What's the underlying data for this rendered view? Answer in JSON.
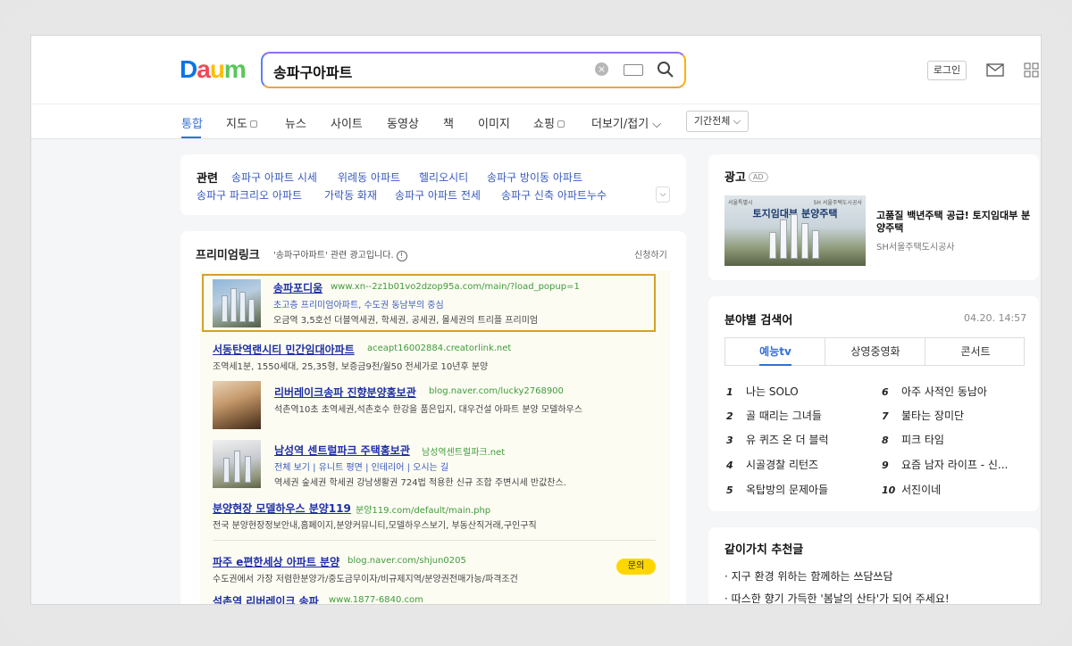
{
  "header": {
    "logo": {
      "d": "D",
      "a": "a",
      "u": "u",
      "m": "m"
    },
    "search_query": "송파구아파트",
    "login_label": "로그인"
  },
  "tabs": [
    {
      "label": "통합",
      "active": true
    },
    {
      "label": "지도",
      "icon": true
    },
    {
      "label": "뉴스"
    },
    {
      "label": "사이트"
    },
    {
      "label": "동영상"
    },
    {
      "label": "책"
    },
    {
      "label": "이미지"
    },
    {
      "label": "쇼핑",
      "icon": true
    },
    {
      "label": "더보기/접기 ⌵"
    }
  ],
  "period_filter": "기간전체 ⌵",
  "related": {
    "title": "관련",
    "links": [
      "송파구 아파트 시세",
      "위례동 아파트",
      "헬리오시티",
      "송파구 방이동 아파트",
      "송파구 파크리오 아파트",
      "가락동 화재",
      "송파구 아파트 전세",
      "송파구 신축 아파트누수"
    ]
  },
  "premium": {
    "title": "프리미엄링크",
    "subtitle": "'송파구아파트' 관련 광고입니다.",
    "apply": "신청하기",
    "ads": [
      {
        "title": "송파포디움",
        "url": "www.xn--2z1b01vo2dzop95a.com/main/?load_popup=1",
        "sub": "초고층 프리미엄아파트, 수도권 동남부의 중심",
        "desc": "오금역 3,5호선 더블역세권, 학세권, 공세권, 몰세권의 트리플 프리미엄"
      },
      {
        "title": "서동탄역랜시티 민간임대아파트",
        "url": "aceapt16002884.creatorlink.net",
        "desc": "조역세1분, 1550세대, 25,35형, 보증금9천/월50 전세가로 10년후 분양"
      },
      {
        "title": "리버레이크송파 진향분양홍보관",
        "url": "blog.naver.com/lucky2768900",
        "desc": "석촌역10초 초역세권,석촌호수 한강을 품은입지, 대우건설 아파트 분양 모델하우스"
      },
      {
        "title": "남성역 센트럴파크 주택홍보관",
        "url": "남성역센트럴파크.net",
        "sub": "전체 보기 | 유니트 평면 | 인테리어 | 오시는 길",
        "desc": "역세권 숲세권 학세권 강남생활권 724법 적용한 신규 조합 주변시세 반값찬스."
      },
      {
        "title": "분양현장 모델하우스 분양119",
        "url": "분양119.com/default/main.php",
        "desc": "전국 분양현장정보안내,홈페이지,분양커뮤니티,모델하우스보기, 부동산직거래,구인구직"
      },
      {
        "title": "파주 e편한세상 아파트 분양",
        "url": "blog.naver.com/shjun0205",
        "desc": "수도권에서 가장 저렴한분양가/중도금무이자/비규제지역/분양권전매가능/파격조건",
        "badge": "문의"
      },
      {
        "title": "석촌역 리버레이크 송파",
        "url": "www.1877-6840.com"
      }
    ]
  },
  "side_ad": {
    "title": "광고",
    "badge": "AD",
    "banner_title": "토지임대부 분양주택",
    "banner_left": "서울특별시",
    "banner_right": "SH 서울주택도시공사",
    "headline": "고품질 백년주택 공급! 토지임대부 분양주택",
    "advertiser": "SH서울주택도시공사"
  },
  "category_search": {
    "title": "분야별 검색어",
    "time": "04.20. 14:57",
    "tabs": [
      "예능tv",
      "상영중영화",
      "콘서트"
    ],
    "ranks": [
      {
        "n": "1",
        "t": "나는 SOLO"
      },
      {
        "n": "2",
        "t": "골 때리는 그녀들"
      },
      {
        "n": "3",
        "t": "유 퀴즈 온 더 블럭"
      },
      {
        "n": "4",
        "t": "시골경찰 리턴즈"
      },
      {
        "n": "5",
        "t": "옥탑방의 문제아들"
      },
      {
        "n": "6",
        "t": "아주 사적인 동남아"
      },
      {
        "n": "7",
        "t": "불타는 장미단"
      },
      {
        "n": "8",
        "t": "피크 타임"
      },
      {
        "n": "9",
        "t": "요즘 남자 라이프 - 신..."
      },
      {
        "n": "10",
        "t": "서진이네"
      }
    ]
  },
  "value_posts": {
    "title": "같이가치 추천글",
    "items": [
      "· 지구 환경 위하는 함께하는 쓰담쓰담",
      "· 따스한 향기 가득한 '봄날의 산타'가 되어 주세요!"
    ]
  }
}
